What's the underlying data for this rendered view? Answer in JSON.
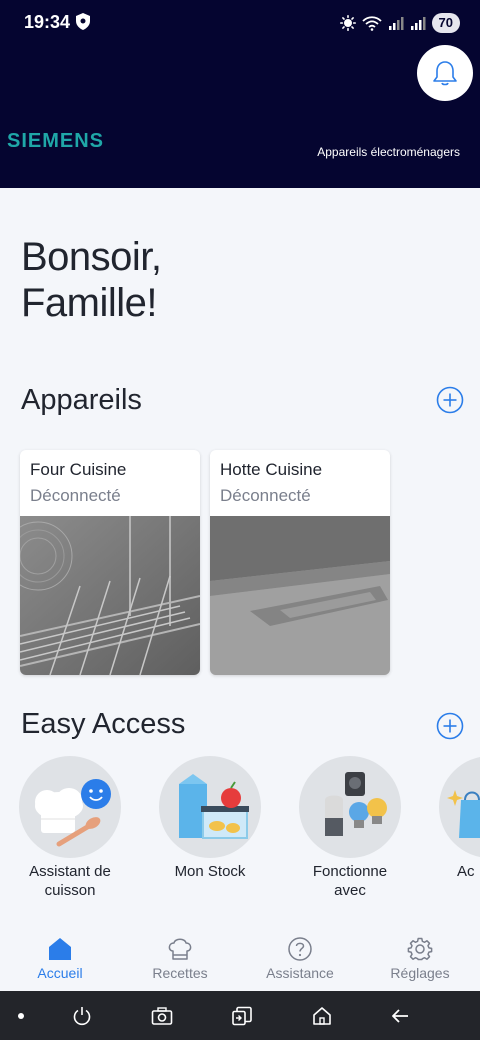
{
  "status_bar": {
    "time": "19:34",
    "battery": "70"
  },
  "header": {
    "brand": "SIEMENS",
    "subtitle": "Appareils électroménagers"
  },
  "greeting": {
    "line1": "Bonsoir,",
    "line2": "Famille!"
  },
  "appliances": {
    "title": "Appareils",
    "items": [
      {
        "name": "Four Cuisine",
        "status": "Déconnecté"
      },
      {
        "name": "Hotte Cuisine",
        "status": "Déconnecté"
      }
    ]
  },
  "easy_access": {
    "title": "Easy Access",
    "items": [
      {
        "label": "Assistant de cuisson"
      },
      {
        "label": "Mon Stock"
      },
      {
        "label": "Fonctionne avec"
      },
      {
        "label": "Ac"
      }
    ]
  },
  "bottom_nav": {
    "items": [
      {
        "label": "Accueil",
        "active": true
      },
      {
        "label": "Recettes"
      },
      {
        "label": "Assistance"
      },
      {
        "label": "Réglages"
      }
    ]
  },
  "colors": {
    "header_bg": "#050530",
    "brand": "#1fa7a8",
    "accent": "#2b7de9"
  }
}
